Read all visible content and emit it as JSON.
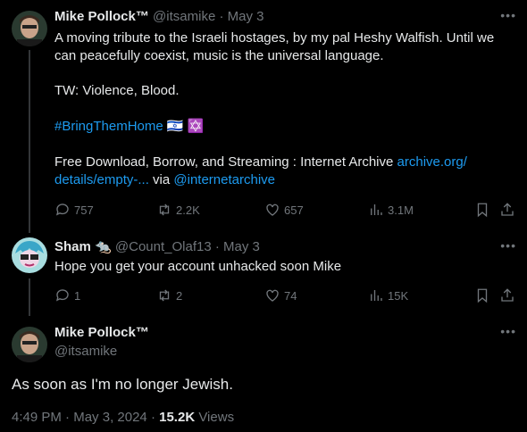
{
  "post1": {
    "name": "Mike Pollock™",
    "handle": "@itsamike",
    "dot": "·",
    "date": "May 3",
    "text_line1": "A moving tribute to the Israeli hostages, by my pal Heshy Walfish. Until we",
    "text_line2": "can peacefully coexist, music is the universal language.",
    "tw": "TW: Violence, Blood.",
    "hashtag": "#BringThemHome",
    "flag_emoji": "🇮🇱",
    "star_emoji": "✡️",
    "free_text": "Free Download, Borrow, and Streaming : Internet Archive ",
    "link1": "archive.org/",
    "link2": "details/empty-...",
    "via": " via ",
    "mention": "@internetarchive",
    "replies": "757",
    "reposts": "2.2K",
    "likes": "657",
    "views": "3.1M"
  },
  "post2": {
    "name": "Sham",
    "emoji": "🐀",
    "handle": "@Count_Olaf13",
    "dot": "·",
    "date": "May 3",
    "text": "Hope you get your account unhacked soon Mike",
    "replies": "1",
    "reposts": "2",
    "likes": "74",
    "views": "15K"
  },
  "main": {
    "name": "Mike Pollock™",
    "handle": "@itsamike",
    "text": "As soon as I'm no longer Jewish.",
    "time": "4:49 PM",
    "dot1": " · ",
    "date": "May 3, 2024",
    "dot2": " · ",
    "views_count": "15.2K",
    "views_label": " Views"
  },
  "icons": {
    "more": "more-icon",
    "reply": "reply-icon",
    "repost": "repost-icon",
    "like": "heart-icon",
    "views": "views-icon",
    "bookmark": "bookmark-icon",
    "share": "share-icon"
  },
  "colors": {
    "background": "#000000",
    "text": "#e7e9ea",
    "muted": "#71767b",
    "link": "#1d9bf0"
  }
}
